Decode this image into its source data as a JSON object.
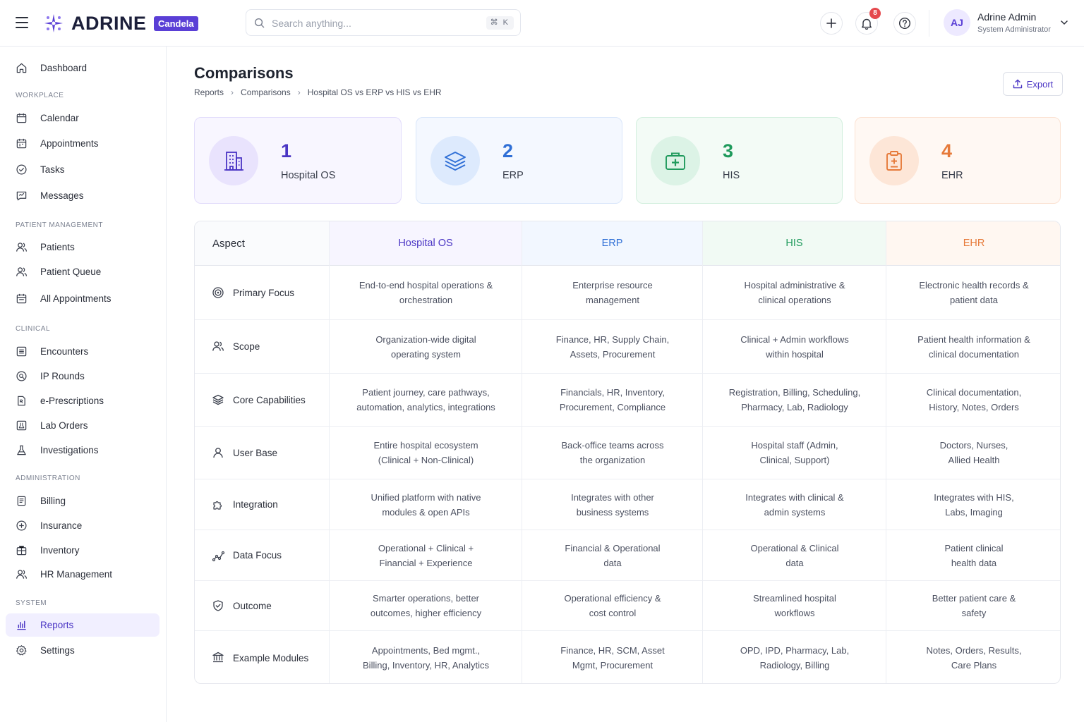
{
  "brand": {
    "name": "ADRINE",
    "badge": "Candela",
    "accent": "#5a3fd6"
  },
  "search": {
    "placeholder": "Search anything...",
    "shortcut": "⌘ K"
  },
  "header": {
    "notifications_count": "8"
  },
  "user": {
    "initials": "AJ",
    "name": "Adrine Admin",
    "role": "System Administrator"
  },
  "sidebar": {
    "top": [
      {
        "label": "Dashboard",
        "icon": "home-icon"
      }
    ],
    "sections": [
      {
        "title": "WORKPLACE",
        "items": [
          {
            "label": "Calendar",
            "icon": "calendar-icon"
          },
          {
            "label": "Appointments",
            "icon": "calendar-icon"
          },
          {
            "label": "Tasks",
            "icon": "check-circle-icon"
          },
          {
            "label": "Messages",
            "icon": "message-icon"
          }
        ]
      },
      {
        "title": "PATIENT MANAGEMENT",
        "items": [
          {
            "label": "Patients",
            "icon": "users-icon"
          },
          {
            "label": "Patient Queue",
            "icon": "users-icon"
          },
          {
            "label": "All Appointments",
            "icon": "calendar-icon"
          }
        ]
      },
      {
        "title": "CLINICAL",
        "items": [
          {
            "label": "Encounters",
            "icon": "list-icon"
          },
          {
            "label": "IP Rounds",
            "icon": "search-circle-icon"
          },
          {
            "label": "e-Prescriptions",
            "icon": "prescription-icon"
          },
          {
            "label": "Lab Orders",
            "icon": "lab-icon"
          },
          {
            "label": "Investigations",
            "icon": "flask-icon"
          }
        ]
      },
      {
        "title": "ADMINISTRATION",
        "items": [
          {
            "label": "Billing",
            "icon": "document-icon"
          },
          {
            "label": "Insurance",
            "icon": "shield-plus-icon"
          },
          {
            "label": "Inventory",
            "icon": "box-icon"
          },
          {
            "label": "HR Management",
            "icon": "users-icon"
          }
        ]
      },
      {
        "title": "SYSTEM",
        "items": [
          {
            "label": "Reports",
            "icon": "bar-chart-icon",
            "active": true
          },
          {
            "label": "Settings",
            "icon": "gear-icon"
          }
        ]
      }
    ]
  },
  "page": {
    "title": "Comparisons",
    "breadcrumb": [
      "Reports",
      "Comparisons",
      "Hospital OS vs ERP vs HIS vs EHR"
    ],
    "export_label": "Export"
  },
  "cards": [
    {
      "number": "1",
      "label": "Hospital OS",
      "icon": "building-icon",
      "color": "#4a35c4"
    },
    {
      "number": "2",
      "label": "ERP",
      "icon": "layers-icon",
      "color": "#2f6fd6"
    },
    {
      "number": "3",
      "label": "HIS",
      "icon": "medical-kit-icon",
      "color": "#1f9a5c"
    },
    {
      "number": "4",
      "label": "EHR",
      "icon": "clipboard-plus-icon",
      "color": "#e67a3a"
    }
  ],
  "table": {
    "header": {
      "aspect": "Aspect",
      "cols": [
        "Hospital OS",
        "ERP",
        "HIS",
        "EHR"
      ]
    },
    "rows": [
      {
        "aspect": "Primary Focus",
        "icon": "target-icon",
        "values": [
          "End-to-end hospital operations & orchestration",
          "Enterprise resource management",
          "Hospital administrative & clinical operations",
          "Electronic health records & patient data"
        ]
      },
      {
        "aspect": "Scope",
        "icon": "users-icon",
        "values": [
          "Organization-wide digital operating system",
          "Finance, HR, Supply Chain, Assets, Procurement",
          "Clinical + Admin workflows within hospital",
          "Patient health information & clinical documentation"
        ]
      },
      {
        "aspect": "Core Capabilities",
        "icon": "layers-icon",
        "values": [
          "Patient journey, care pathways, automation, analytics, integrations",
          "Financials, HR, Inventory, Procurement, Compliance",
          "Registration, Billing, Scheduling, Pharmacy, Lab, Radiology",
          "Clinical documentation, History, Notes, Orders"
        ]
      },
      {
        "aspect": "User Base",
        "icon": "user-icon",
        "values": [
          "Entire hospital ecosystem (Clinical + Non-Clinical)",
          "Back-office teams across the organization",
          "Hospital staff (Admin, Clinical, Support)",
          "Doctors, Nurses, Allied Health"
        ]
      },
      {
        "aspect": "Integration",
        "icon": "puzzle-icon",
        "values": [
          "Unified platform with native modules & open APIs",
          "Integrates with other business systems",
          "Integrates with clinical & admin systems",
          "Integrates with HIS, Labs, Imaging"
        ]
      },
      {
        "aspect": "Data Focus",
        "icon": "chart-nodes-icon",
        "values": [
          "Operational + Clinical + Financial + Experience",
          "Financial & Operational data",
          "Operational & Clinical data",
          "Patient clinical health data"
        ]
      },
      {
        "aspect": "Outcome",
        "icon": "shield-check-icon",
        "values": [
          "Smarter operations, better outcomes, higher efficiency",
          "Operational efficiency & cost control",
          "Streamlined hospital workflows",
          "Better patient care & safety"
        ]
      },
      {
        "aspect": "Example Modules",
        "icon": "bank-icon",
        "values": [
          "Appointments, Bed mgmt., Billing, Inventory, HR, Analytics",
          "Finance, HR, SCM, Asset Mgmt, Procurement",
          "OPD, IPD, Pharmacy, Lab, Radiology, Billing",
          "Notes, Orders, Results, Care Plans"
        ]
      }
    ]
  }
}
